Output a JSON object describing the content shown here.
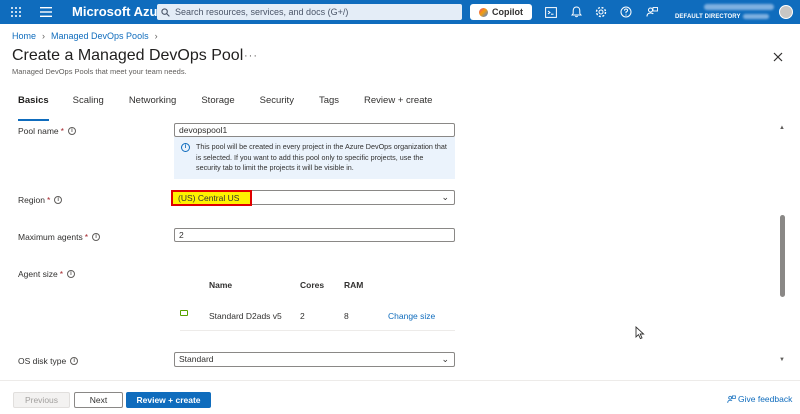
{
  "topbar": {
    "brand": "Microsoft Azure",
    "search_placeholder": "Search resources, services, and docs (G+/)",
    "copilot_label": "Copilot",
    "directory_label": "DEFAULT DIRECTORY"
  },
  "breadcrumb": [
    "Home",
    "Managed DevOps Pools"
  ],
  "page": {
    "title": "Create a Managed DevOps Pool",
    "subtitle": "Managed DevOps Pools that meet your team needs."
  },
  "tabs": [
    "Basics",
    "Scaling",
    "Networking",
    "Storage",
    "Security",
    "Tags",
    "Review + create"
  ],
  "active_tab": "Basics",
  "form": {
    "pool_name": {
      "label": "Pool name",
      "required": "*",
      "value": "devopspool1"
    },
    "pool_info": "This pool will be created in every project in the Azure DevOps organization that is selected. If you want to add this pool only to specific projects, use the security tab to limit the projects it will be visible in.",
    "region": {
      "label": "Region",
      "required": "*",
      "value": "(US) Central US"
    },
    "maximum_agents": {
      "label": "Maximum agents",
      "required": "*",
      "value": "2"
    },
    "agent_size": {
      "label": "Agent size",
      "required": "*",
      "columns": [
        "Name",
        "Cores",
        "RAM"
      ],
      "row": {
        "name": "Standard D2ads v5",
        "cores": "2",
        "ram": "8",
        "action": "Change size"
      }
    },
    "os_disk_type": {
      "label": "OS disk type",
      "value": "Standard"
    }
  },
  "footer": {
    "previous": "Previous",
    "next": "Next",
    "review_create": "Review + create",
    "feedback": "Give feedback"
  },
  "colors": {
    "accent": "#0f6cbd",
    "highlight_fill": "#fff200",
    "highlight_border": "#e00000"
  }
}
